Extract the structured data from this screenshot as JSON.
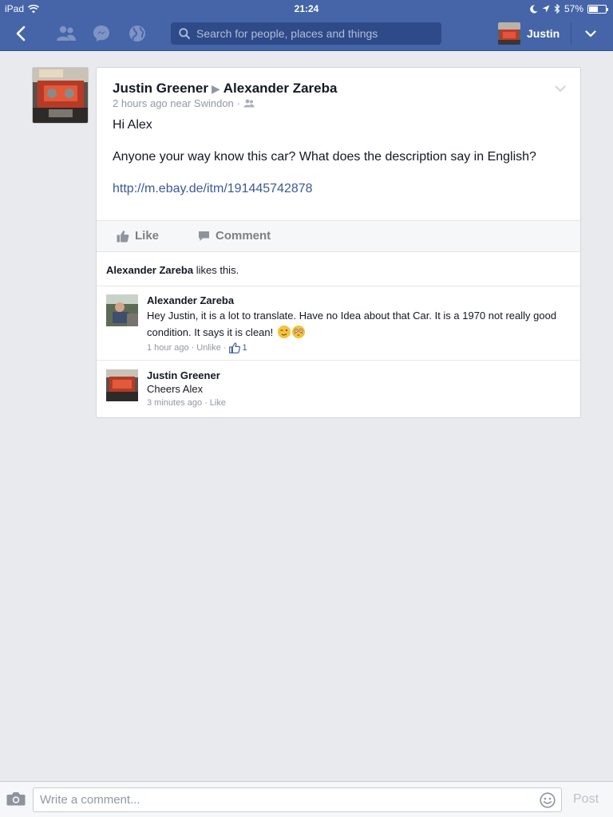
{
  "status_bar": {
    "device": "iPad",
    "time": "21:24",
    "battery_percent": "57%",
    "battery_level": 0.57
  },
  "nav": {
    "search_placeholder": "Search for people, places and things",
    "profile_name": "Justin"
  },
  "post": {
    "author": "Justin Greener",
    "target": "Alexander Zareba",
    "meta": "2 hours ago near Swindon",
    "meta_sep": "·",
    "body_line1": "Hi Alex",
    "body_line2": "Anyone your way know this car? What does the description say in English?",
    "link": "http://m.ebay.de/itm/191445742878",
    "like_label": "Like",
    "comment_label": "Comment"
  },
  "likes": {
    "name": "Alexander Zareba",
    "suffix": " likes this."
  },
  "comments": [
    {
      "author": "Alexander Zareba",
      "text": "Hey Justin, it is a lot to translate.  Have no Idea about that Car. It is a 1970 not really good condition. It says it is clean!",
      "time": "1 hour ago",
      "action": "Unlike",
      "like_count": "1",
      "sep": "·"
    },
    {
      "author": "Justin Greener",
      "text": "Cheers Alex",
      "time": "3 minutes ago",
      "action": "Like",
      "sep": "·"
    }
  ],
  "composer": {
    "placeholder": "Write a comment...",
    "post_label": "Post"
  },
  "colors": {
    "header_blue": "#4565a8",
    "link_blue": "#3b5998",
    "background": "#e9eaed"
  }
}
